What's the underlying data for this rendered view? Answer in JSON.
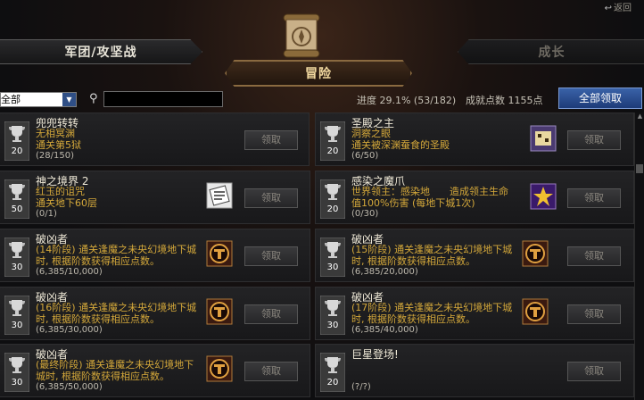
{
  "header": {
    "back_label": "返回"
  },
  "tabs": {
    "left": "军团/攻坚战",
    "center": "冒险",
    "right": "成长"
  },
  "filter": {
    "selected": "全部"
  },
  "search": {
    "value": ""
  },
  "stats": {
    "progress": "进度 29.1% (53/182)",
    "points": "成就点数 1155点"
  },
  "claim_all_label": "全部领取",
  "cards": [
    {
      "title": "兜兜转转",
      "desc": "无相冥渊\n通关第5狱",
      "count": "(28/150)",
      "points": "20",
      "claim": "领取",
      "badge": ""
    },
    {
      "title": "圣殿之主",
      "desc": "洞察之眼\n通关被深渊蚕食的圣殿",
      "count": "(6/50)",
      "points": "20",
      "claim": "领取",
      "badge": "tile"
    },
    {
      "title": "神之境界 2",
      "desc": "红玉的诅咒\n通关地下60层",
      "count": "(0/1)",
      "points": "50",
      "claim": "领取",
      "badge": "scroll"
    },
    {
      "title": "感染之魔爪",
      "desc": "世界领主：感染地　　造成领主生命值100%伤害 (每地下城1次)",
      "count": "(0/30)",
      "points": "20",
      "claim": "领取",
      "badge": "star"
    },
    {
      "title": "破凶者",
      "desc": "(14阶段) 通关逢魔之未央幻境地下城时, 根据阶数获得相应点数。",
      "count": "(6,385/10,000)",
      "points": "30",
      "claim": "领取",
      "badge": "emblem"
    },
    {
      "title": "破凶者",
      "desc": "(15阶段) 通关逢魔之未央幻境地下城时, 根据阶数获得相应点数。",
      "count": "(6,385/20,000)",
      "points": "30",
      "claim": "领取",
      "badge": "emblem"
    },
    {
      "title": "破凶者",
      "desc": "(16阶段) 通关逢魔之未央幻境地下城时, 根据阶数获得相应点数。",
      "count": "(6,385/30,000)",
      "points": "30",
      "claim": "领取",
      "badge": "emblem"
    },
    {
      "title": "破凶者",
      "desc": "(17阶段) 通关逢魔之未央幻境地下城时, 根据阶数获得相应点数。",
      "count": "(6,385/40,000)",
      "points": "30",
      "claim": "领取",
      "badge": "emblem"
    },
    {
      "title": "破凶者",
      "desc": "(最终阶段) 通关逢魔之未央幻境地下城时, 根据阶数获得相应点数。",
      "count": "(6,385/50,000)",
      "points": "30",
      "claim": "领取",
      "badge": "emblem"
    },
    {
      "title": "巨星登场!",
      "desc": "",
      "count": "(?/?)",
      "points": "20",
      "claim": "领取",
      "badge": ""
    }
  ]
}
